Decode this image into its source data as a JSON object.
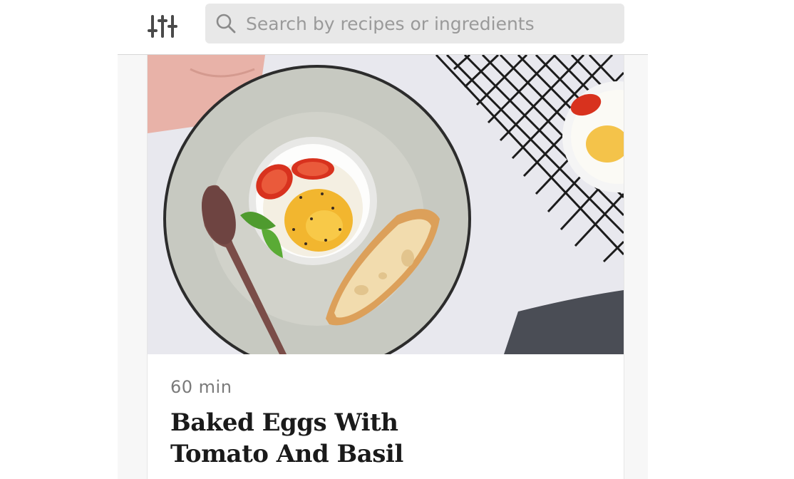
{
  "header": {
    "filter_icon": "filter-sliders-icon",
    "search": {
      "icon": "search-icon",
      "placeholder": "Search by recipes or ingredients",
      "value": ""
    }
  },
  "recipe_card": {
    "image_alt": "Baked eggs in ramekin with tomato and basil on a plate",
    "time": "60 min",
    "title": "Baked Eggs With Tomato And Basil"
  },
  "colors": {
    "search_bg": "#e8e8e8",
    "icon": "#4a4a4a",
    "title": "#1a1a1a",
    "meta": "#7a7a7a"
  }
}
